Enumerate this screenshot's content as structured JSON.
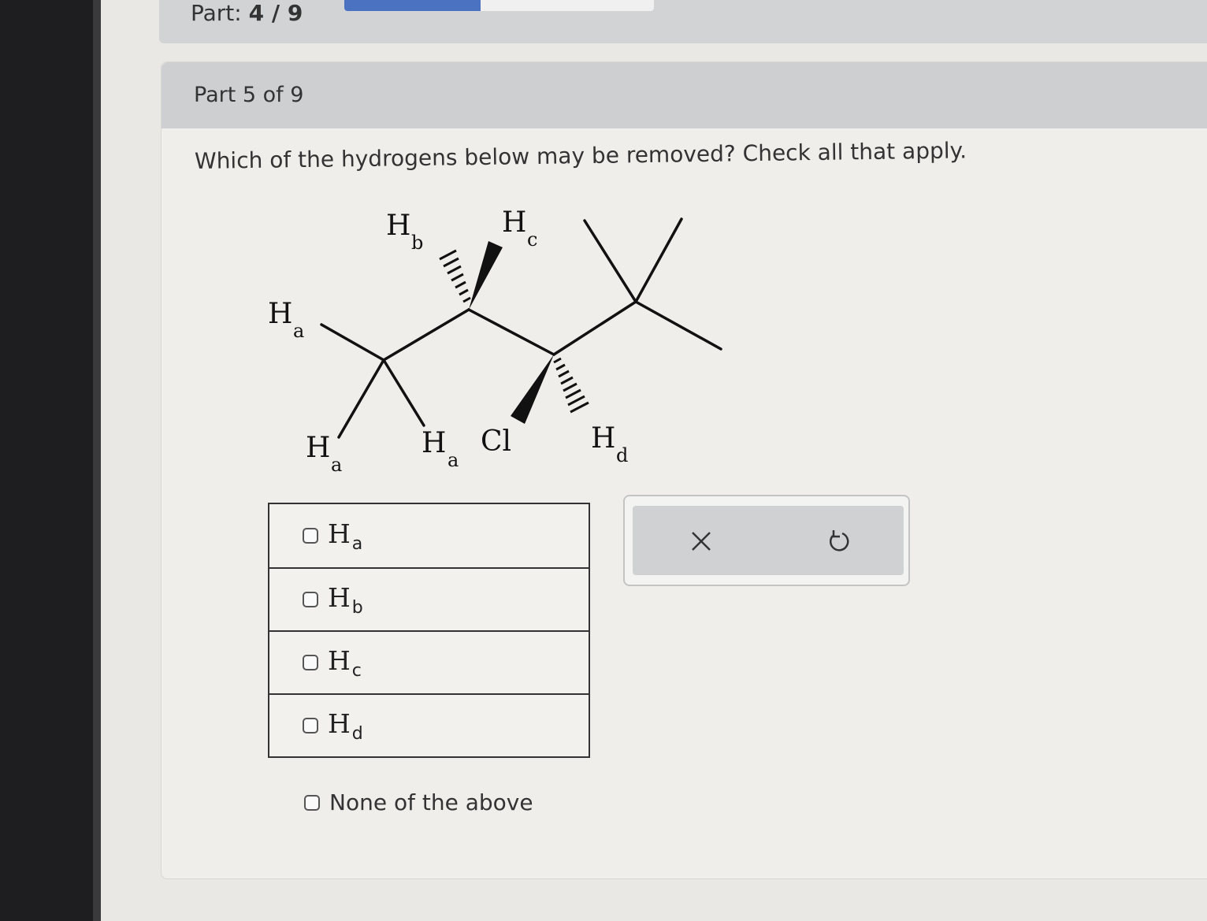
{
  "part_bar": {
    "label": "Part:",
    "value": "4 / 9",
    "progress": 0.44
  },
  "card": {
    "header": "Part 5 of 9"
  },
  "question": "Which of the hydrogens below may be removed? Check all that apply.",
  "molecule": {
    "labels": [
      {
        "letter": "H",
        "sub": "b"
      },
      {
        "letter": "H",
        "sub": "c"
      },
      {
        "letter": "H",
        "sub": "a"
      },
      {
        "letter": "H",
        "sub": "a"
      },
      {
        "letter": "H",
        "sub": "a"
      },
      {
        "letter": "Cl",
        "sub": ""
      },
      {
        "letter": "H",
        "sub": "d"
      }
    ]
  },
  "options": [
    {
      "letter": "H",
      "sub": "a"
    },
    {
      "letter": "H",
      "sub": "b"
    },
    {
      "letter": "H",
      "sub": "c"
    },
    {
      "letter": "H",
      "sub": "d"
    }
  ],
  "none_option": "None of the above",
  "tools": {
    "clear_icon": "close-icon",
    "undo_icon": "undo-icon"
  },
  "colors": {
    "progress": "#4a72c0",
    "header": "#cdcfd0"
  }
}
